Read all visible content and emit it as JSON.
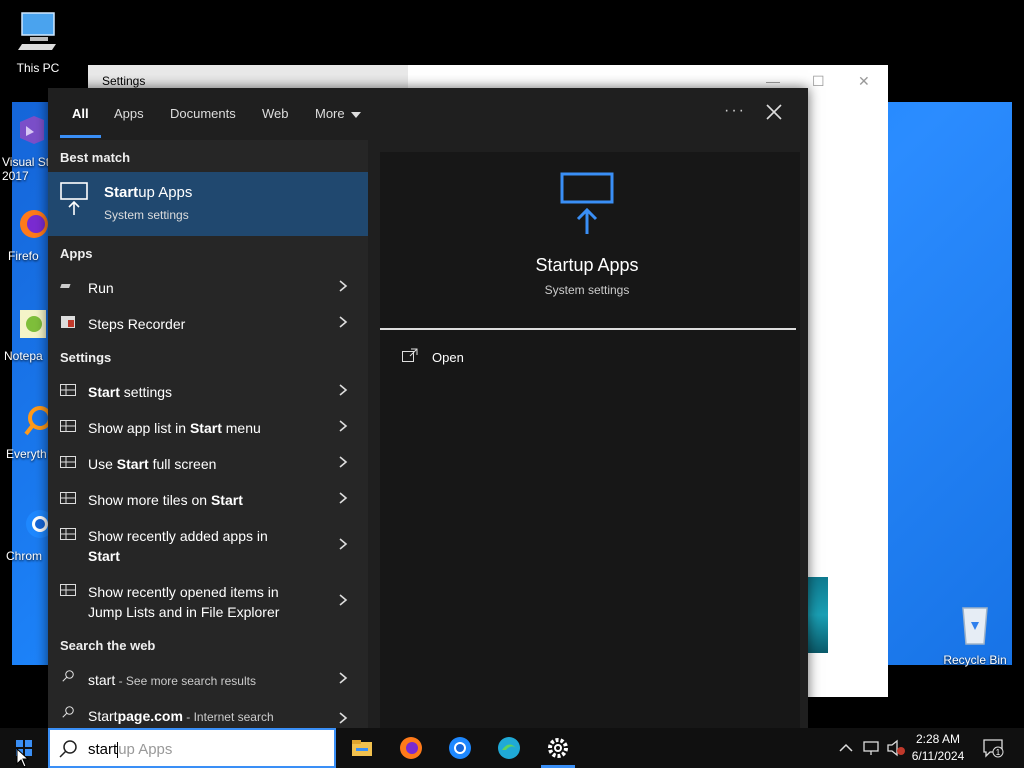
{
  "desktop": {
    "icons": [
      {
        "label": "This PC"
      },
      {
        "label": "Visual St\n2017"
      },
      {
        "label": "Firefo"
      },
      {
        "label": "Notepa"
      },
      {
        "label": "Everyth"
      },
      {
        "label": "Chrom"
      },
      {
        "label": "Recycle Bin"
      }
    ]
  },
  "settings_window": {
    "title": "Settings",
    "minimize": "—",
    "maximize": "☐",
    "close": "✕"
  },
  "search": {
    "tabs": [
      {
        "label": "All",
        "active": true
      },
      {
        "label": "Apps"
      },
      {
        "label": "Documents"
      },
      {
        "label": "Web"
      },
      {
        "label": "More"
      }
    ],
    "more_dots": "···",
    "best_match_heading": "Best match",
    "best_match": {
      "title_bold": "Start",
      "title_rest": "up Apps",
      "subtitle": "System settings"
    },
    "apps_heading": "Apps",
    "apps": [
      {
        "label": "Run"
      },
      {
        "label": "Steps Recorder"
      }
    ],
    "settings_heading": "Settings",
    "settings": [
      {
        "pre": "",
        "bold": "Start",
        "post": " settings"
      },
      {
        "pre": "Show app list in ",
        "bold": "Start",
        "post": " menu"
      },
      {
        "pre": "Use ",
        "bold": "Start",
        "post": " full screen"
      },
      {
        "pre": "Show more tiles on ",
        "bold": "Start",
        "post": ""
      },
      {
        "line1": "Show recently added apps in",
        "line2": "Start"
      },
      {
        "line1": "Show recently opened items in",
        "line2": "Jump Lists and in File Explorer"
      }
    ],
    "web_heading": "Search the web",
    "web": [
      {
        "term": "start",
        "sub": " - See more search results"
      },
      {
        "term_plain": "Start",
        "term_bold": "page.com",
        "sub": " - Internet search"
      }
    ],
    "preview": {
      "title": "Startup Apps",
      "subtitle": "System settings",
      "action": "Open"
    },
    "accent": "#3a8ff6"
  },
  "taskbar": {
    "search_typed": "start",
    "search_hint": "up Apps",
    "clock_time": "2:28 AM",
    "clock_date": "6/11/2024",
    "notification_count": "1"
  }
}
